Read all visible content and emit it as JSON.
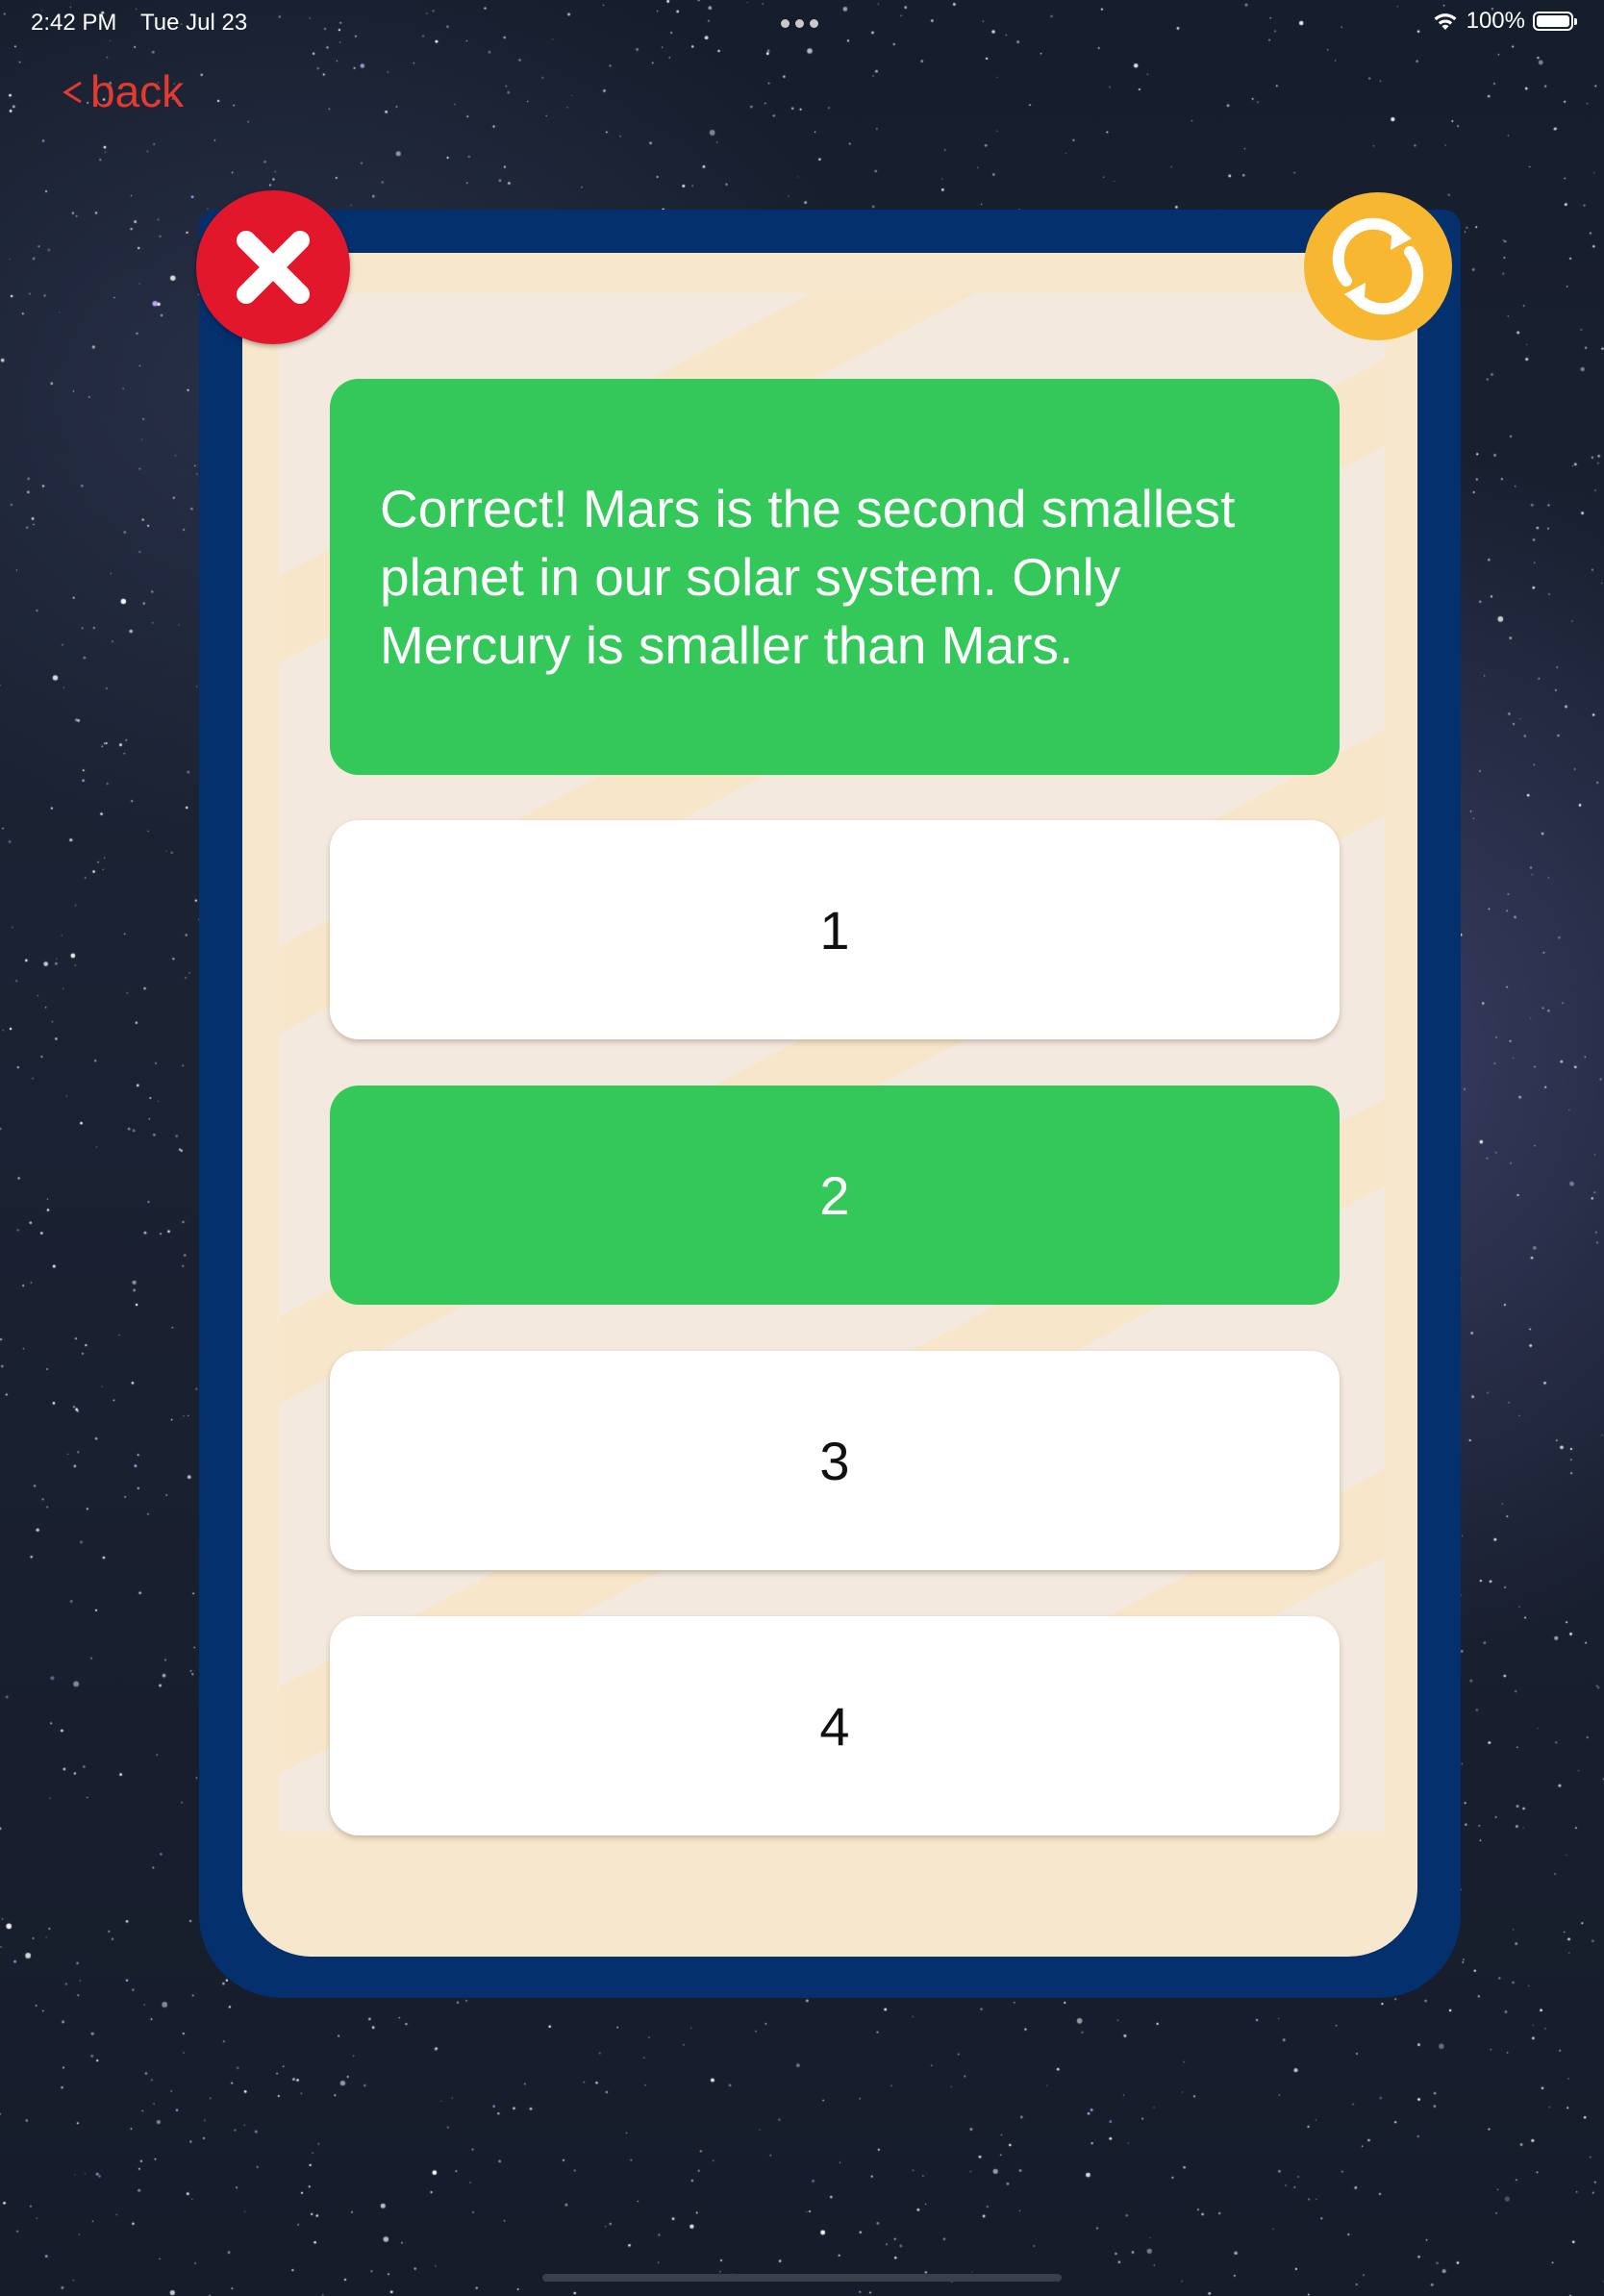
{
  "status_bar": {
    "time": "2:42 PM",
    "date": "Tue Jul 23",
    "battery": "100%",
    "icons": [
      "wifi-icon",
      "battery-icon"
    ]
  },
  "nav": {
    "back_label": "back",
    "back_icon": "chevron-left-icon"
  },
  "card": {
    "close_icon": "close-icon",
    "refresh_icon": "refresh-icon",
    "feedback": "Correct! Mars is the second smallest planet in our solar system. Only Mercury is smaller than Mars.",
    "answers": [
      {
        "label": "1",
        "state": "default"
      },
      {
        "label": "2",
        "state": "correct"
      },
      {
        "label": "3",
        "state": "default"
      },
      {
        "label": "4",
        "state": "default"
      }
    ]
  },
  "colors": {
    "accent_red": "#e43a2f",
    "correct_green": "#34c75a",
    "card_border": "#04316e",
    "card_fill": "#f7e8cd",
    "refresh_yellow": "#f7b731",
    "close_red": "#e3172b"
  }
}
